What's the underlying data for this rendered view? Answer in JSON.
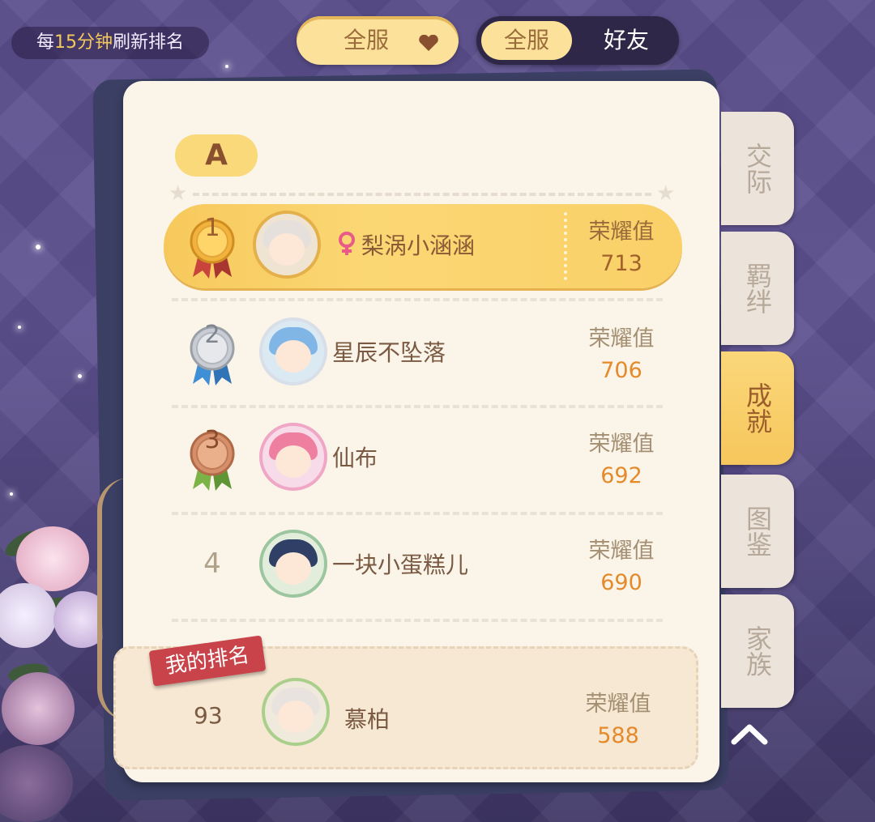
{
  "header": {
    "refresh_prefix": "每",
    "refresh_highlight": "15分钟",
    "refresh_suffix": "刷新排名",
    "scope_dropdown": "全服",
    "scope_toggle": [
      "全服",
      "好友"
    ]
  },
  "grade": "A",
  "leaderboard": [
    {
      "rank": "1",
      "name": "梨涡小涵涵",
      "score_label": "荣耀值",
      "score": "713",
      "gender": "female"
    },
    {
      "rank": "2",
      "name": "星辰不坠落",
      "score_label": "荣耀值",
      "score": "706"
    },
    {
      "rank": "3",
      "name": "仙布",
      "score_label": "荣耀值",
      "score": "692"
    },
    {
      "rank": "4",
      "name": "一块小蛋糕儿",
      "score_label": "荣耀值",
      "score": "690"
    }
  ],
  "my_rank": {
    "tag": "我的排名",
    "rank": "93",
    "name": "慕柏",
    "score_label": "荣耀值",
    "score": "588"
  },
  "side_tabs": [
    "交际",
    "羁绊",
    "成就",
    "图鉴",
    "家族"
  ],
  "active_tab": "成就",
  "colors": {
    "gold": "#fbe199",
    "accent_orange": "#e48a2a",
    "tag_red": "#c8444a"
  }
}
